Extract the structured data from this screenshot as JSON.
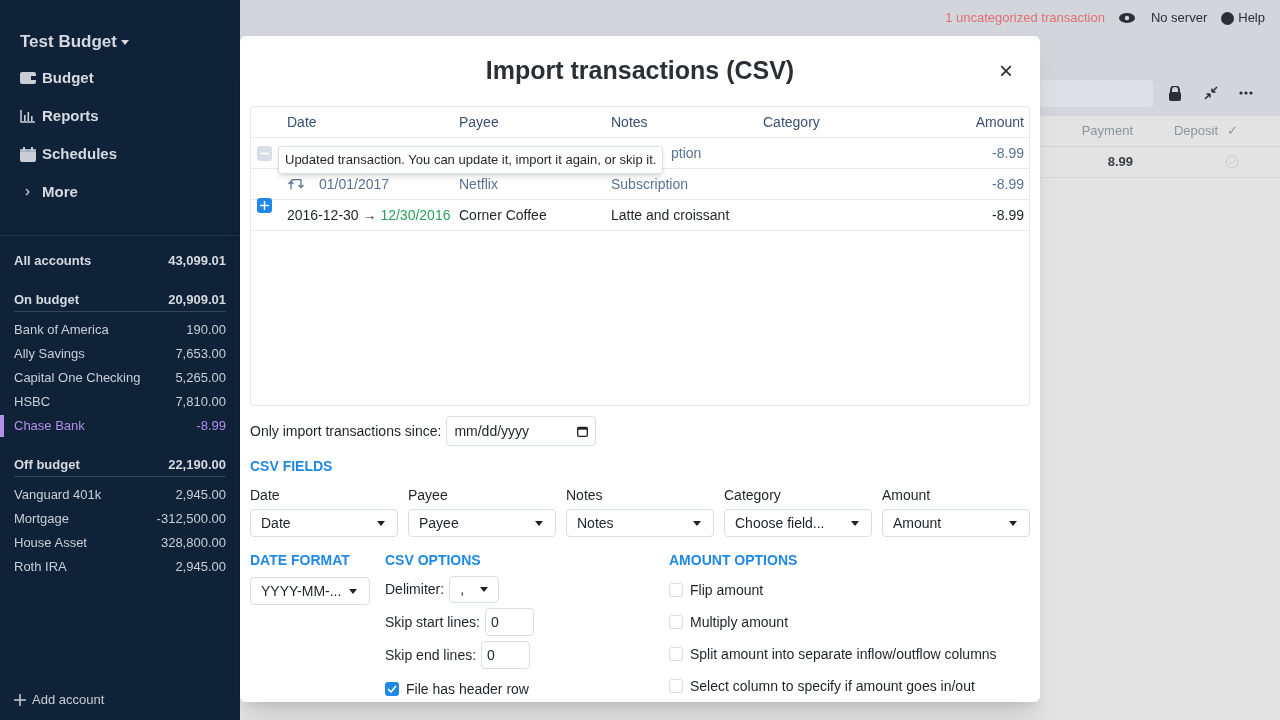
{
  "sidebar": {
    "budget_name": "Test Budget",
    "nav": [
      {
        "label": "Budget"
      },
      {
        "label": "Reports"
      },
      {
        "label": "Schedules"
      },
      {
        "label": "More"
      }
    ],
    "account_groups": [
      {
        "name": "All accounts",
        "balance": "43,099.01"
      },
      {
        "name": "On budget",
        "balance": "20,909.01",
        "accounts": [
          {
            "name": "Bank of America",
            "balance": "190.00",
            "selected": false
          },
          {
            "name": "Ally Savings",
            "balance": "7,653.00",
            "selected": false
          },
          {
            "name": "Capital One Checking",
            "balance": "5,265.00",
            "selected": false
          },
          {
            "name": "HSBC",
            "balance": "7,810.00",
            "selected": false
          },
          {
            "name": "Chase Bank",
            "balance": "-8.99",
            "selected": true
          }
        ]
      },
      {
        "name": "Off budget",
        "balance": "22,190.00",
        "accounts": [
          {
            "name": "Vanguard 401k",
            "balance": "2,945.00",
            "selected": false
          },
          {
            "name": "Mortgage",
            "balance": "-312,500.00",
            "selected": false
          },
          {
            "name": "House Asset",
            "balance": "328,800.00",
            "selected": false
          },
          {
            "name": "Roth IRA",
            "balance": "2,945.00",
            "selected": false
          }
        ]
      }
    ],
    "add_account": "Add account"
  },
  "top_bar": {
    "warning": "1 uncategorized transaction",
    "server": "No server",
    "help": "Help"
  },
  "background_table": {
    "columns": [
      "Payment",
      "Deposit",
      "✓"
    ],
    "rows": [
      {
        "payment": "8.99",
        "cleared": false
      }
    ]
  },
  "dialog": {
    "title": "Import transactions (CSV)",
    "close": "×",
    "table": {
      "columns": [
        "Date",
        "Payee",
        "Notes",
        "Category",
        "Amount"
      ],
      "rows": [
        {
          "kind": "existing",
          "selected": false,
          "notes": "ption",
          "amount": "-8.99"
        },
        {
          "kind": "child",
          "date": "01/01/2017",
          "payee": "Netflix",
          "notes": "Subscription",
          "amount": "-8.99"
        },
        {
          "kind": "new",
          "selected": true,
          "date_raw": "2016-12-30",
          "arrow": "→",
          "date": "12/30/2016",
          "payee": "Corner Coffee",
          "notes": "Latte and croissant",
          "amount": "-8.99"
        }
      ],
      "tooltip": "Updated transaction. You can update it, import it again, or skip it."
    },
    "since": {
      "label": "Only import transactions since:",
      "placeholder": "mm/dd/yyyy"
    },
    "csv_fields": {
      "heading": "CSV FIELDS",
      "fields": [
        {
          "label": "Date",
          "value": "Date"
        },
        {
          "label": "Payee",
          "value": "Payee"
        },
        {
          "label": "Notes",
          "value": "Notes"
        },
        {
          "label": "Category",
          "value": "Choose field..."
        },
        {
          "label": "Amount",
          "value": "Amount"
        }
      ]
    },
    "date_format": {
      "heading": "DATE FORMAT",
      "value": "YYYY-MM-..."
    },
    "csv_options": {
      "heading": "CSV OPTIONS",
      "delimiter_label": "Delimiter:",
      "delimiter": ",",
      "skip_start_label": "Skip start lines:",
      "skip_start": "0",
      "skip_end_label": "Skip end lines:",
      "skip_end": "0",
      "header_row": {
        "label": "File has header row",
        "checked": true
      }
    },
    "amount_options": {
      "heading": "AMOUNT OPTIONS",
      "options": [
        {
          "label": "Flip amount",
          "checked": false
        },
        {
          "label": "Multiply amount",
          "checked": false
        },
        {
          "label": "Split amount into separate inflow/outflow columns",
          "checked": false
        },
        {
          "label": "Select column to specify if amount goes in/out",
          "checked": false
        }
      ]
    }
  }
}
